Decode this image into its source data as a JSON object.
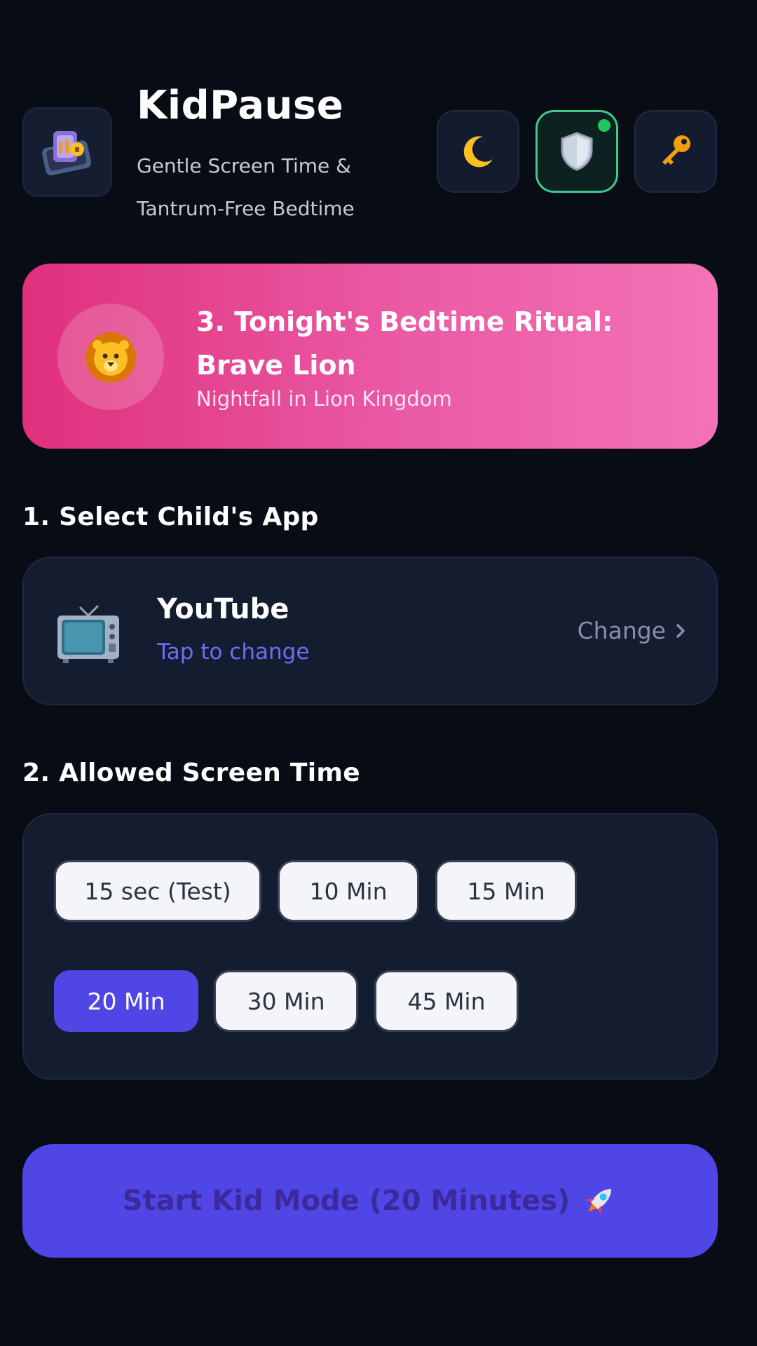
{
  "header": {
    "app_title": "KidPause",
    "tagline": "Gentle Screen Time & Tantrum-Free Bedtime",
    "logo_icon": "phone-lock-icon",
    "buttons": [
      {
        "icon": "moon-icon",
        "state": "default"
      },
      {
        "icon": "shield-icon",
        "state": "active",
        "status_color": "#22c55e"
      },
      {
        "icon": "key-icon",
        "state": "default"
      }
    ]
  },
  "ritual": {
    "title": "3. Tonight's Bedtime Ritual: Brave Lion",
    "subtitle": "Nightfall in Lion Kingdom",
    "icon": "lion-icon",
    "gradient": [
      "#e0307c",
      "#f472b6"
    ]
  },
  "app_section": {
    "heading": "1. Select Child's App",
    "app_name": "YouTube",
    "hint": "Tap to change",
    "change_label": "Change",
    "icon": "tv-icon"
  },
  "time_section": {
    "heading": "2. Allowed Screen Time",
    "options": [
      "15 sec (Test)",
      "10 Min",
      "15 Min",
      "20 Min",
      "30 Min",
      "45 Min"
    ],
    "selected": "20 Min"
  },
  "start_button": {
    "label": "Start Kid Mode (20 Minutes)",
    "icon": "rocket-icon"
  },
  "colors": {
    "background": "#080c14",
    "card": "#141c30",
    "accent": "#4f46e5",
    "link": "#6d6ef5"
  }
}
